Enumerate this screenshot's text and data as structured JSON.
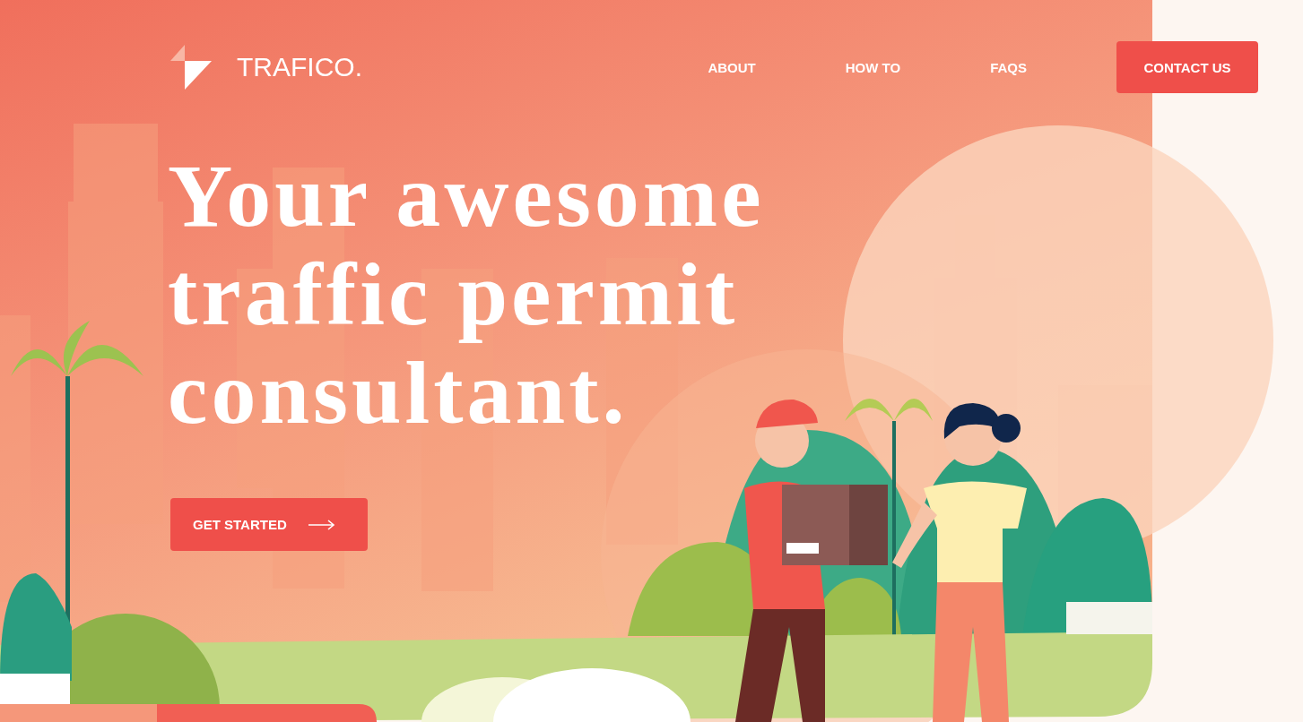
{
  "brand": {
    "name": "TRAFICO."
  },
  "nav": [
    {
      "label": "ABOUT",
      "kind": "link"
    },
    {
      "label": "HOW TO",
      "kind": "link"
    },
    {
      "label": "FAQS",
      "kind": "link"
    },
    {
      "label": "CONTACT US",
      "kind": "button"
    }
  ],
  "hero": {
    "headline": "Your awesome traffic permit consultant.",
    "cta": "GET STARTED"
  }
}
